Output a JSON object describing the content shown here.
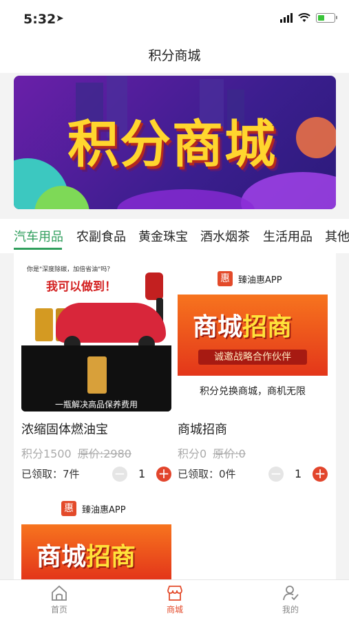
{
  "status": {
    "time": "5:32"
  },
  "header": {
    "title": "积分商城"
  },
  "banner": {
    "title": "积分商城"
  },
  "categories": [
    "汽车用品",
    "农副食品",
    "黄金珠宝",
    "酒水烟茶",
    "生活用品",
    "其他"
  ],
  "products": [
    {
      "name": "浓缩固体燃油宝",
      "points_label": "积分1500",
      "original_label": "原价:2980",
      "claimed_label": "已领取：7件",
      "qty": "1",
      "image": {
        "top_text": "你是\"深度除碳，加倍省油\"吗？",
        "headline": "我可以做到！",
        "bottom_text": "一瓶解决高品保养费用"
      }
    },
    {
      "name": "商城招商",
      "points_label": "积分0",
      "original_label": "原价:0",
      "claimed_label": "已领取：0件",
      "qty": "1",
      "image": {
        "brand": "臻油惠APP",
        "headline_a": "商城",
        "headline_b": "招商",
        "ribbon": "诚邀战略合作伙伴",
        "caption": "积分兑换商城，商机无限"
      }
    },
    {
      "image": {
        "brand": "臻油惠APP",
        "headline_a": "商城",
        "headline_b": "招商"
      }
    }
  ],
  "tabbar": [
    {
      "label": "首页",
      "icon": "home-icon"
    },
    {
      "label": "商城",
      "icon": "shop-icon"
    },
    {
      "label": "我的",
      "icon": "profile-icon"
    }
  ],
  "colors": {
    "accent_green": "#2f9e5c",
    "accent_red": "#e34a2a"
  }
}
